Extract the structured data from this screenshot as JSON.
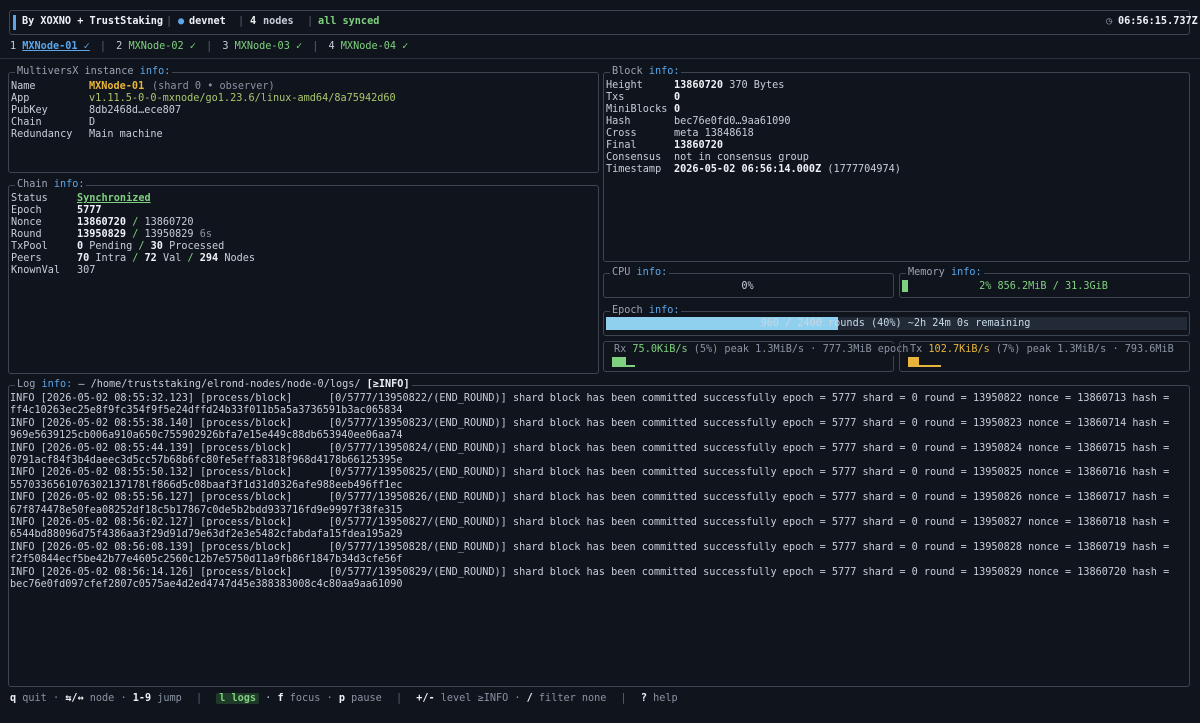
{
  "header": {
    "brand": "By XOXNO + TrustStaking",
    "network_dot": "●",
    "network": "devnet",
    "nodes_count": "4",
    "nodes_label": "nodes",
    "sync_status": "all synced",
    "clock_icon": "◷",
    "time": "06:56:15.737Z"
  },
  "tabs": [
    {
      "num": "1",
      "label": "MXNode-01 ✓",
      "active": true
    },
    {
      "num": "2",
      "label": "MXNode-02 ✓",
      "active": false
    },
    {
      "num": "3",
      "label": "MXNode-03 ✓",
      "active": false
    },
    {
      "num": "4",
      "label": "MXNode-04 ✓",
      "active": false
    }
  ],
  "instance": {
    "title": "MultiversX instance",
    "info": "info:",
    "name_k": "Name",
    "name_v": "MXNode-01",
    "name_extra": "(shard 0 • observer)",
    "app_k": "App",
    "app_v": "v1.11.5-0-0-mxnode/go1.23.6/linux-amd64/8a75942d60",
    "pubkey_k": "PubKey",
    "pubkey_v": "8db2468d…ece807",
    "chain_k": "Chain",
    "chain_v": "D",
    "redundancy_k": "Redundancy",
    "redundancy_v": "Main machine"
  },
  "chain": {
    "title": "Chain",
    "info": "info:",
    "status_k": "Status",
    "status_v": "Synchronized",
    "epoch_k": "Epoch",
    "epoch_v": "5777",
    "nonce_k": "Nonce",
    "nonce_v": "13860720",
    "nonce_sep": "/",
    "nonce_of": "13860720",
    "round_k": "Round",
    "round_v": "13950829",
    "round_sep": "/",
    "round_of": "13950829",
    "round_time": "6s",
    "txpool_k": "TxPool",
    "txpool_pending": "0",
    "txpool_pending_label": "Pending",
    "txpool_sep": "/",
    "txpool_processed": "30",
    "txpool_processed_label": "Processed",
    "peers_k": "Peers",
    "peers_intra": "70",
    "peers_intra_label": "Intra",
    "peers_sep1": "/",
    "peers_val": "72",
    "peers_val_label": "Val",
    "peers_sep2": "/",
    "peers_nodes": "294",
    "peers_nodes_label": "Nodes",
    "knownval_k": "KnownVal",
    "knownval_v": "307"
  },
  "block": {
    "title": "Block",
    "info": "info:",
    "height_k": "Height",
    "height_v": "13860720",
    "height_size": "370 Bytes",
    "txs_k": "Txs",
    "txs_v": "0",
    "miniblocks_k": "MiniBlocks",
    "miniblocks_v": "0",
    "hash_k": "Hash",
    "hash_v": "bec76e0fd0…9aa61090",
    "cross_k": "Cross",
    "cross_v": "meta 13848618",
    "final_k": "Final",
    "final_v": "13860720",
    "consensus_k": "Consensus",
    "consensus_v": "not in consensus group",
    "timestamp_k": "Timestamp",
    "timestamp_v": "2026-05-02 06:56:14.000Z",
    "timestamp_unix": "(1777704974)"
  },
  "cpu": {
    "title": "CPU",
    "info": "info:",
    "value": "0%",
    "fraction": 0.0
  },
  "memory": {
    "title": "Memory",
    "info": "info:",
    "percent": "2%",
    "usage": "856.2MiB / 31.3GiB",
    "fraction": 0.02
  },
  "epoch": {
    "title": "Epoch",
    "info": "info:",
    "text": "960 / 2400 rounds  (40%)  ~2h 24m 0s remaining",
    "fraction": 0.4
  },
  "rx": {
    "label": "Rx",
    "rate": "75.0KiB/s",
    "detail": "(5%) peak 1.3MiB/s · 777.3MiB epoch"
  },
  "tx": {
    "label": "Tx",
    "rate": "102.7KiB/s",
    "detail": "(7%) peak 1.3MiB/s · 793.6MiB"
  },
  "log": {
    "title": "Log",
    "info": "info:",
    "path": "— /home/truststaking/elrond-nodes/node-0/logs/",
    "level": "[≥INFO]",
    "lines": [
      "INFO [2026-05-02 08:55:32.123] [process/block]      [0/5777/13950822/(END_ROUND)] shard block has been committed successfully epoch = 5777 shard = 0 round = 13950822 nonce = 13860713 hash =",
      "ff4c10263ec25e8f9fc354f9f5e24dffd24b33f011b5a5a3736591b3ac065834",
      "INFO [2026-05-02 08:55:38.140] [process/block]      [0/5777/13950823/(END_ROUND)] shard block has been committed successfully epoch = 5777 shard = 0 round = 13950823 nonce = 13860714 hash =",
      "969e5639125cb006a910a650c755902926bfa7e15e449c88db653940ee06aa74",
      "INFO [2026-05-02 08:55:44.139] [process/block]      [0/5777/13950824/(END_ROUND)] shard block has been committed successfully epoch = 5777 shard = 0 round = 13950824 nonce = 13860715 hash =",
      "0791acf84f3b4daeec3d5cc57b68b6fc80fe5effa8318f968d4178b66125395e",
      "INFO [2026-05-02 08:55:50.132] [process/block]      [0/5777/13950825/(END_ROUND)] shard block has been committed successfully epoch = 5777 shard = 0 round = 13950825 nonce = 13860716 hash =",
      "5570336561076302137178lf866d5c08baaf3f1d31d0326afe988eeb496ff1ec",
      "INFO [2026-05-02 08:55:56.127] [process/block]      [0/5777/13950826/(END_ROUND)] shard block has been committed successfully epoch = 5777 shard = 0 round = 13950826 nonce = 13860717 hash =",
      "67f874478e50fea08252df18c5b17867c0de5b2bdd933716fd9e9997f38fe315",
      "INFO [2026-05-02 08:56:02.127] [process/block]      [0/5777/13950827/(END_ROUND)] shard block has been committed successfully epoch = 5777 shard = 0 round = 13950827 nonce = 13860718 hash =",
      "6544bd88096d75f4386aa3f29d91d79e63df2e3e5482cfabdafa15fdea195a29",
      "INFO [2026-05-02 08:56:08.139] [process/block]      [0/5777/13950828/(END_ROUND)] shard block has been committed successfully epoch = 5777 shard = 0 round = 13950828 nonce = 13860719 hash =",
      "f2f50844ecf5be42b77e4605c2560c12b7e5750d11a9fb86f1847b34d3cfe56f",
      "INFO [2026-05-02 08:56:14.126] [process/block]      [0/5777/13950829/(END_ROUND)] shard block has been committed successfully epoch = 5777 shard = 0 round = 13950829 nonce = 13860720 hash =",
      "bec76e0fd097cfef2807c0575ae4d2ed4747d45e388383008c4c80aa9aa61090"
    ]
  },
  "footer": {
    "quit_key": "q",
    "quit_label": "quit ·",
    "node_key": "⇆/↔",
    "node_label": "node ·",
    "jump_key": "1-9",
    "jump_label": "jump",
    "sep1": "|",
    "logs_key": "l logs",
    "focus_key": "f",
    "focus_label": "focus ·",
    "pause_key": "p",
    "pause_label": "pause",
    "sep2": "|",
    "level_key": "+/-",
    "level_label": "level ≥INFO ·",
    "filter_key": "/",
    "filter_label": "filter none",
    "sep3": "|",
    "help_key": "?",
    "help_label": "help"
  },
  "colors": {
    "accent": "#5aa6e8",
    "ok": "#7fd17f",
    "warn": "#e8b53a",
    "bg": "#10141d"
  }
}
